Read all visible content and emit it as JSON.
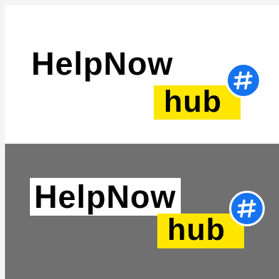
{
  "logo": {
    "brand_main": "HelpNow",
    "brand_sub": "hub"
  },
  "colors": {
    "sub_highlight": "#ffe600",
    "badge": "#1673f0",
    "dark_background": "#707070"
  },
  "icons": {
    "badge_icon": "hashtag-icon"
  }
}
